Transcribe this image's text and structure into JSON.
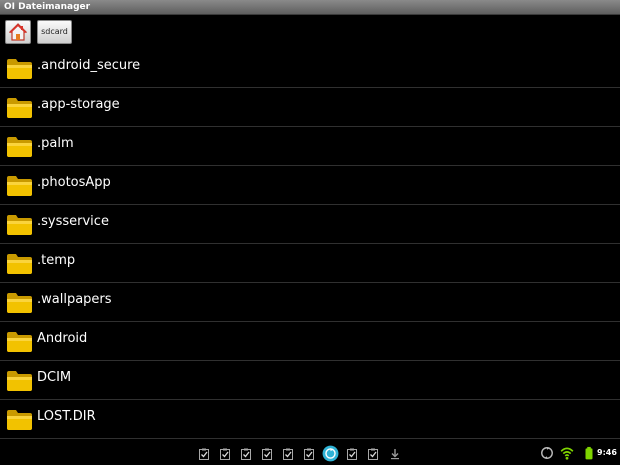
{
  "window": {
    "title": "OI Dateimanager"
  },
  "toolbar": {
    "home_icon": "home-icon",
    "breadcrumb_label": "sdcard"
  },
  "files": [
    {
      "name": ".android_secure",
      "icon": "folder-icon"
    },
    {
      "name": ".app-storage",
      "icon": "folder-icon"
    },
    {
      "name": ".palm",
      "icon": "folder-icon"
    },
    {
      "name": ".photosApp",
      "icon": "folder-icon"
    },
    {
      "name": ".sysservice",
      "icon": "folder-icon"
    },
    {
      "name": ".temp",
      "icon": "folder-icon"
    },
    {
      "name": ".wallpapers",
      "icon": "folder-icon"
    },
    {
      "name": "Android",
      "icon": "folder-icon"
    },
    {
      "name": "DCIM",
      "icon": "folder-icon"
    },
    {
      "name": "LOST.DIR",
      "icon": "folder-icon"
    }
  ],
  "statusbar": {
    "notifications": [
      "clipboard-check-icon",
      "clipboard-check-icon",
      "clipboard-check-icon",
      "clipboard-check-icon",
      "clipboard-check-icon",
      "clipboard-check-icon",
      "sync-icon",
      "clipboard-check-icon",
      "clipboard-check-icon",
      "download-icon"
    ],
    "right_icons": [
      "sync-status-icon",
      "wifi-icon",
      "battery-icon"
    ],
    "clock": "9:46"
  },
  "colors": {
    "background": "#000000",
    "folder": "#f2c200",
    "wifi": "#7fd400",
    "battery": "#7fd400",
    "active_notification": "#2fb3d6"
  }
}
